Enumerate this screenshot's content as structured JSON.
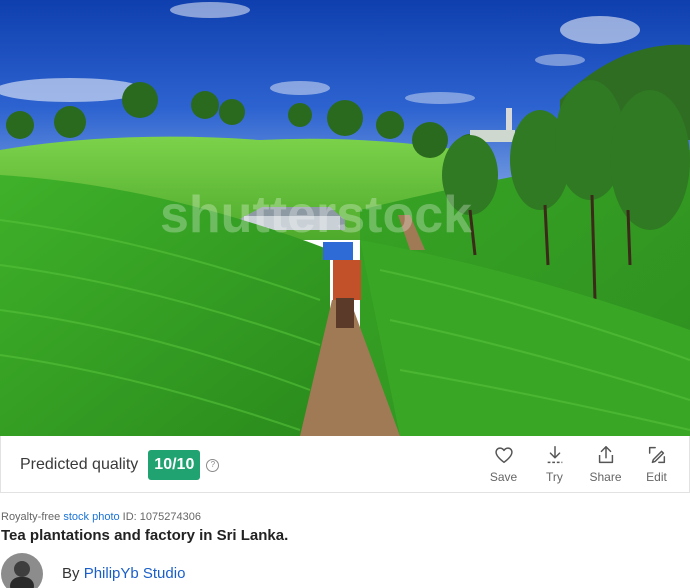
{
  "photo": {
    "alt": "Tea plantations and factory in Sri Lanka",
    "watermark": "shutterstock"
  },
  "quality": {
    "label": "Predicted quality",
    "score": "10/10",
    "help_glyph": "?",
    "badge_color": "#20a271"
  },
  "actions": [
    {
      "label": "Save",
      "icon": "heart-icon"
    },
    {
      "label": "Try",
      "icon": "download-icon"
    },
    {
      "label": "Share",
      "icon": "share-icon"
    },
    {
      "label": "Edit",
      "icon": "edit-icon"
    }
  ],
  "meta": {
    "prefix": "Royalty-free ",
    "link_text": "stock photo",
    "id_text": " ID: 1075274306"
  },
  "title": "Tea plantations and factory in Sri Lanka.",
  "author": {
    "by": "By ",
    "name": "PhilipYb Studio"
  }
}
